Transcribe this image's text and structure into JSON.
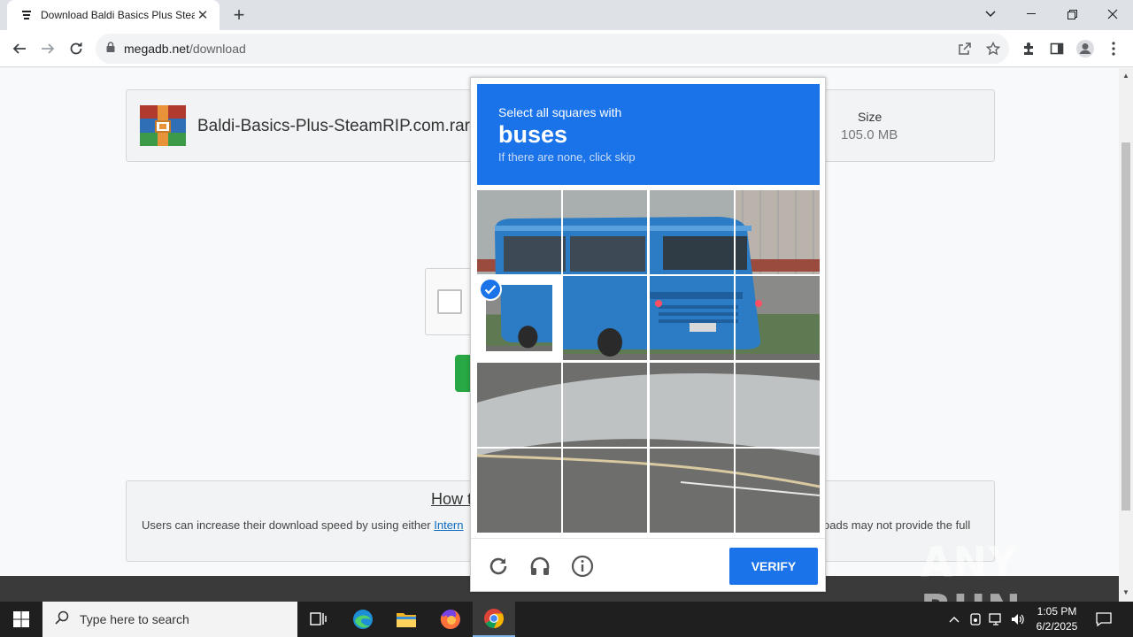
{
  "browser": {
    "tab_title": "Download Baldi Basics Plus Stea",
    "url_host": "megadb.net",
    "url_path": "/download"
  },
  "page": {
    "file_name": "Baldi-Basics-Plus-SteamRIP.com.rar",
    "size_label": "Size",
    "size_value": "105.0 MB",
    "info_title": "How t",
    "info_text_left": "Users can increase their download speed by using either ",
    "info_link": "Intern",
    "info_text_right": "oads may not provide the full"
  },
  "captcha": {
    "instruction": "Select all squares with",
    "target": "buses",
    "hint": "If there are none, click skip",
    "verify_label": "VERIFY",
    "selected_tiles": [
      4
    ],
    "accent_color": "#1a73e8"
  },
  "watermark": "ANY RUN",
  "taskbar": {
    "search_placeholder": "Type here to search",
    "time": "1:05 PM",
    "date": "6/2/2025"
  }
}
